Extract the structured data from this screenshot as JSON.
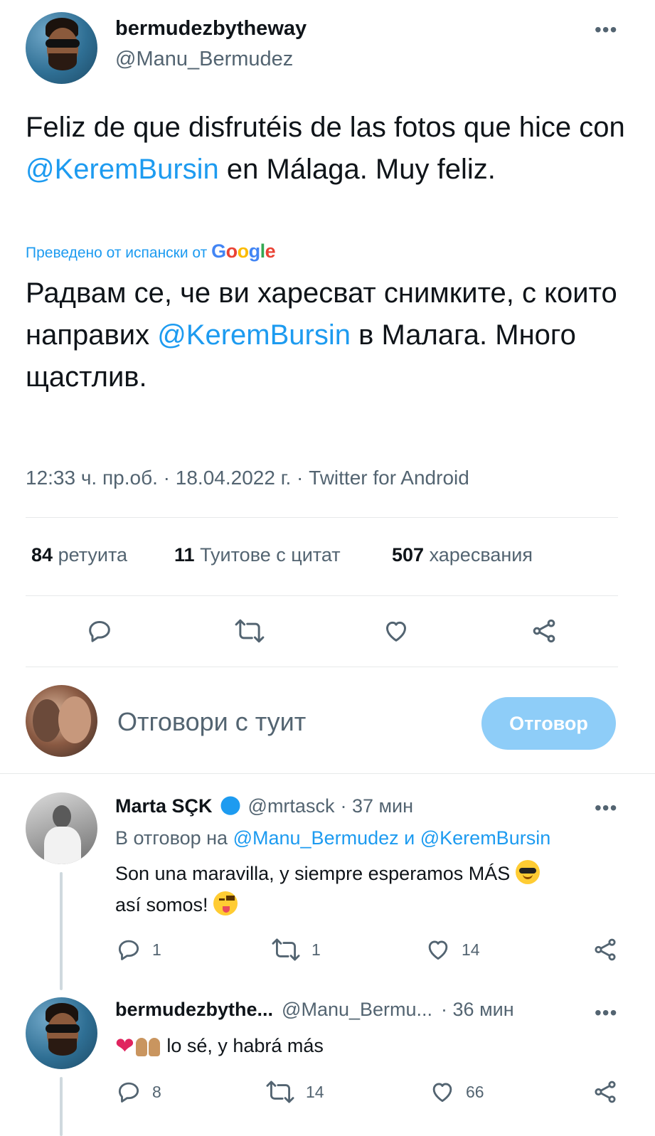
{
  "tweet": {
    "display_name": "bermudezbytheway",
    "handle": "@Manu_Bermudez",
    "text_part1": "Feliz de que disfrutéis de las fotos que hice con ",
    "mention1": "@KeremBursin",
    "text_part2": " en Málaga. Muy feliz.",
    "translated_label": "Преведено от испански от",
    "translator": "Google",
    "trans_part1": "Радвам се, че ви харесват снимките, с които направих ",
    "trans_mention": "@KeremBursin",
    "trans_part2": " в Малага. Много щастлив.",
    "timestamp": "12:33 ч. пр.об. · 18.04.2022 г. · Twitter for Android"
  },
  "stats": {
    "retweets_count": "84",
    "retweets_label": "ретуита",
    "quotes_count": "11",
    "quotes_label": "Туитове с цитат",
    "likes_count": "507",
    "likes_label": "харесвания"
  },
  "compose": {
    "placeholder": "Отговори с туит",
    "reply_button": "Отговор"
  },
  "replies": [
    {
      "name": "Marta SÇK",
      "handle": "@mrtasck",
      "time": "· 37 мин",
      "in_reply_label": "В отговор на",
      "in_reply_user1": "@Manu_Bermudez",
      "in_reply_and": "и",
      "in_reply_user2": "@KeremBursin",
      "text_line1": "Son una maravilla, y siempre esperamos MÁS",
      "text_line2": "así somos!",
      "replies": "1",
      "retweets": "1",
      "likes": "14"
    },
    {
      "name": "bermudezbythe...",
      "handle": "@Manu_Bermu...",
      "time": "· 36 мин",
      "text": "lo sé, y habrá más",
      "replies": "8",
      "retweets": "14",
      "likes": "66"
    }
  ],
  "colors": {
    "link": "#1d9bf0",
    "muted": "#536471",
    "reply_button_bg": "#8ecdf8",
    "verified": "#1d9bf0"
  }
}
